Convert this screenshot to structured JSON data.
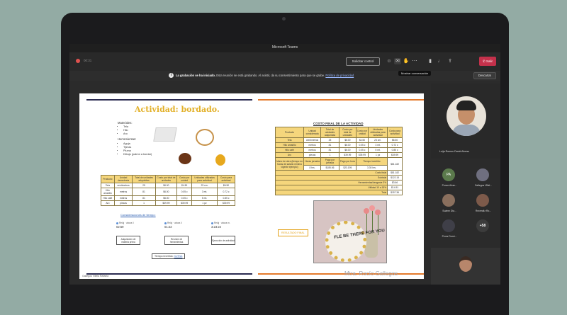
{
  "app": {
    "title": "Microsoft Teams",
    "timer": "00:31"
  },
  "toolbar": {
    "request_control": "Solicitar control",
    "leave": "Salir",
    "tooltip": "Mostrar conversación",
    "icons": [
      "people-icon",
      "chat-icon",
      "reactions-icon",
      "more-icon",
      "camera-icon",
      "mic-icon",
      "share-icon"
    ]
  },
  "banner": {
    "bold": "La grabación se ha iniciado.",
    "text": "Esta reunión se está grabando. Al asistir, da su consentimiento para que se grabe.",
    "link": "Política de privacidad",
    "dismiss": "Descartar"
  },
  "slide": {
    "title": "Actividad: bordado.",
    "materials_head": "Materiales:",
    "materials": [
      "Tela",
      "Hilo",
      "Aro"
    ],
    "tools_head": "Herramientas:",
    "tools": [
      "Aguja",
      "Tijeras",
      "Pluma",
      "Dibujo (patrón a bordar)"
    ],
    "table": {
      "headers": [
        "Producto",
        "Unidad demedesia",
        "Total de unidades adquiridas",
        "Costo por total de unidades",
        "Costo por unidad",
        "Unidades utilizadas para actividad",
        "Costo para actividad"
      ],
      "rows": [
        [
          "Tela",
          "centímetros",
          "25",
          "$6.00",
          "$4.50",
          "23 cm.",
          "$6.50"
        ],
        [
          "Hilo amarillo",
          "metros",
          "81",
          "$6.00",
          "0.05 c",
          "3 mt.",
          "0.72 c"
        ],
        [
          "Hilo café",
          "metros",
          "81",
          "$6.00",
          "0.05 c",
          "5 mt.",
          "0.85 c"
        ],
        [
          "Aro",
          "piezas",
          "1",
          "$39.99",
          "$39.99",
          "1 pz",
          "$39.99"
        ]
      ]
    },
    "considerations": "Consideraciones de tiempo:",
    "clocks": [
      {
        "label": "Reloj · ahora \\/",
        "time": "02:59"
      },
      {
        "label": "Reloj · ahora \\/",
        "time": "01:23"
      },
      {
        "label": "Reloj · ahora m.",
        "time": "3:23:24"
      }
    ],
    "steps": [
      "Adquisición de materia prima",
      "Reunión de herramientas",
      "Ejecución de actividad"
    ],
    "total_time_label": "Tiempo invertido:",
    "total_time_value": "3.27hrs",
    "final_title": "COSTO FINAL DE LA ACTIVIDAD",
    "final_table": {
      "headers": [
        "Producto",
        "Unidad considerada",
        "Total de unidades adquiridas",
        "Costo por total de unidades",
        "Costo por unidad",
        "Unidades utilizadas para actividad",
        "Costo para actividad"
      ],
      "rows": [
        [
          "Tela",
          "centímetros",
          "25",
          "$6.00",
          "$4.50",
          "23 cm.",
          "$6.50"
        ],
        [
          "Hilo amarillo",
          "metros",
          "81",
          "$6.00",
          "0.05 c",
          "3 mt.",
          "0.72 c"
        ],
        [
          "Hilo café",
          "metros",
          "81",
          "$6.00",
          "0.05 c",
          "5 mt.",
          "0.85 c"
        ],
        [
          "Aro",
          "piezas",
          "1",
          "$39.99",
          "$39.99",
          "1 pz",
          "$39.99"
        ]
      ],
      "labor_headers": [
        "Mano de obra (tiempo en horas de salario mínimo vigente ejemplo)",
        "Horas jornada",
        "Pago por jornada",
        "Pago por hora",
        "Tiempo invertido"
      ],
      "labor_row": [
        "8 hrs.",
        "$185.56",
        "$23.195",
        "3.30 hrs."
      ],
      "labor_total": "$81.182",
      "summary": [
        {
          "label": "Subtotal",
          "value": "$122.15"
        },
        {
          "label": "Herramientas/desgaste  3%",
          "value": "$3.66"
        },
        {
          "label": "Utilidad  10 a 15%",
          "value": "$14.51"
        },
        {
          "label": "Total",
          "value": "$157.36"
        }
      ],
      "costo_label": "Costo/total",
      "costo_value": "$81.182"
    },
    "result_label": "RESULTADO FINAL",
    "photo_text": "FLE BE THERE FOR YOU",
    "teacher": "Mtra. Rocío Gallegos"
  },
  "presenter": "Gallegos Villela Rafaela",
  "participants": {
    "main": "Luija Romon David Alonso",
    "tiles": [
      {
        "initials": "PA",
        "name": "Ponce Alvar...",
        "color": "#5b7a4c"
      },
      {
        "initials": "",
        "name": "Gallegos Villel...",
        "color": "#6f6f7f"
      },
      {
        "initials": "",
        "name": "Suárez Dia...",
        "color": "#8a6f5d"
      },
      {
        "initials": "",
        "name": "Recendiz Ro...",
        "color": "#7d5a4a"
      },
      {
        "initials": "",
        "name": "Perez Domí...",
        "color": "#3f3f48"
      },
      {
        "initials": "+58",
        "name": "",
        "color": "#3c3c3c"
      }
    ]
  },
  "colors": {
    "accent_orange": "#e57a2b",
    "accent_navy": "#2a2a50",
    "title_gold": "#e3b12a",
    "leave_red": "#c4314b"
  }
}
